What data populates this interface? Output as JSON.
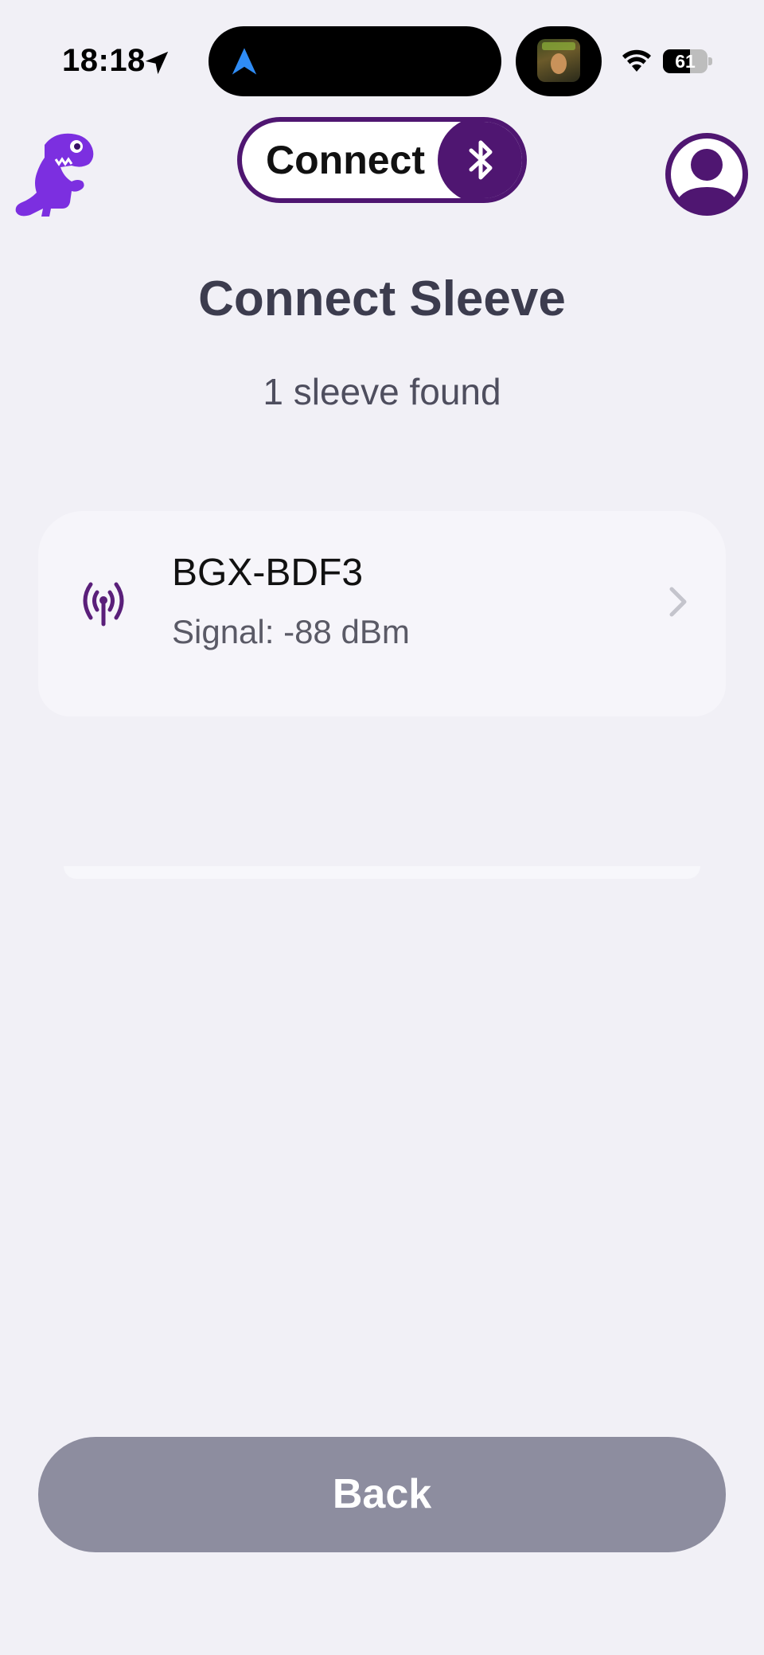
{
  "status_bar": {
    "time": "18:18",
    "battery_level": "61",
    "battery_fraction": 0.61,
    "icons": [
      "location-arrow-icon",
      "navigation-arrow-icon",
      "album-art-icon",
      "wifi-icon",
      "battery-icon"
    ]
  },
  "header": {
    "connect_label": "Connect",
    "icons": [
      "dino-logo-icon",
      "bluetooth-icon",
      "profile-icon"
    ],
    "accent_color": "#4f1671",
    "logo_color": "#7c2fe0"
  },
  "page": {
    "title": "Connect Sleeve",
    "subtitle": "1 sleeve found"
  },
  "devices": [
    {
      "name": "BGX-BDF3",
      "signal": "Signal: -88 dBm",
      "icon": "antenna-signal-icon"
    }
  ],
  "footer": {
    "back_label": "Back",
    "back_color": "#8d8d9f"
  }
}
